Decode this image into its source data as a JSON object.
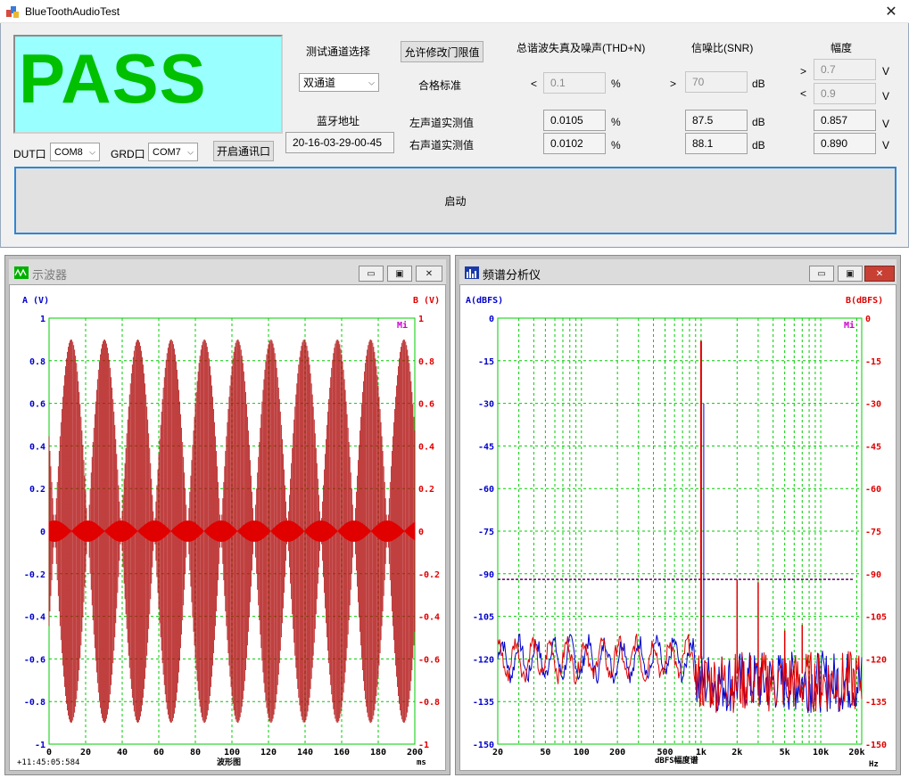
{
  "window": {
    "title": "BlueToothAudioTest",
    "close_glyph": "✕"
  },
  "status": {
    "result": "PASS"
  },
  "ports": {
    "dut_label": "DUT口",
    "dut_value": "COM8",
    "grd_label": "GRD口",
    "grd_value": "COM7",
    "open_button": "开启通讯口"
  },
  "channel": {
    "label": "测试通道选择",
    "value": "双通道"
  },
  "bluetooth": {
    "label": "蓝牙地址",
    "value": "20-16-03-29-00-45"
  },
  "limits": {
    "edit_button": "允许修改门限值",
    "standard_label": "合格标准"
  },
  "rows": {
    "left_label": "左声道实测值",
    "right_label": "右声道实测值"
  },
  "thd": {
    "header": "总谐波失真及噪声(THD+N)",
    "op": "<",
    "limit": "0.1",
    "unit": "%",
    "left": "0.0105",
    "right": "0.0102"
  },
  "snr": {
    "header": "信噪比(SNR)",
    "op": ">",
    "limit": "70",
    "unit": "dB",
    "left": "87.5",
    "right": "88.1"
  },
  "amplitude": {
    "header": "幅度",
    "op_min": ">",
    "min": "0.7",
    "op_max": "<",
    "max": "0.9",
    "unit": "V",
    "left": "0.857",
    "right": "0.890"
  },
  "start_button": "启动",
  "icons": {
    "app": "bluetooth-app-icon",
    "oscilloscope": "oscilloscope-icon",
    "spectrum": "spectrum-icon"
  },
  "oscilloscope": {
    "title": "示波器",
    "left_axis_title": "A (V)",
    "right_axis_title": "B (V)",
    "corner_marker": "Mi",
    "timestamp": "+11:45:05:584",
    "x_title": "波形图",
    "x_unit": "ms",
    "minimize_glyph": "▭",
    "maximize_glyph": "▣",
    "close_glyph": "✕"
  },
  "spectrum": {
    "title": "频谱分析仪",
    "left_axis_title": "A(dBFS)",
    "right_axis_title": "B(dBFS)",
    "corner_marker": "Mi",
    "x_title": "dBFS幅度谱",
    "x_unit": "Hz",
    "minimize_glyph": "▭",
    "maximize_glyph": "▣",
    "close_glyph": "✕"
  },
  "colors": {
    "pass_bg": "#99ffff",
    "pass_text": "#00c000",
    "channel_a": "#0000cc",
    "channel_b": "#e00000",
    "grid": "#00cc00",
    "start_border": "#2e86d4",
    "threshold": "#660066"
  },
  "chart_data": [
    {
      "type": "line",
      "x": [
        0,
        200
      ],
      "x_ticks": [
        0,
        20,
        40,
        60,
        80,
        100,
        120,
        140,
        160,
        180,
        200
      ],
      "xlim": [
        0,
        200
      ],
      "ylim": [
        -1,
        1
      ],
      "y_ticks_left": [
        "1",
        "0.8",
        "0.6",
        "0.4",
        "0.2",
        "0",
        "-0.2",
        "-0.4",
        "-0.6",
        "-0.8",
        "-1"
      ],
      "y_ticks_right": [
        "1",
        "0.8",
        "0.6",
        "0.4",
        "0.2",
        "0",
        "-0.2",
        "-0.4",
        "-0.6",
        "-0.8",
        "-1"
      ],
      "y_tick_values": [
        1,
        0.8,
        0.6,
        0.4,
        0.2,
        0,
        -0.2,
        -0.4,
        -0.6,
        -0.8,
        -1
      ],
      "carrier_khz": 1,
      "envelope_period_ms": 18.2,
      "envelope_peaks": 11,
      "series": [
        {
          "peak": 0.9
        },
        {
          "peak": 0.05
        }
      ],
      "grid": true
    },
    {
      "type": "line",
      "x_scale": "log",
      "xlim": [
        20,
        22000
      ],
      "ylim": [
        -150,
        0
      ],
      "x_ticks": [
        "20",
        "50",
        "100",
        "200",
        "500",
        "1k",
        "2k",
        "5k",
        "10k",
        "20k"
      ],
      "x_tick_values": [
        20,
        50,
        100,
        200,
        500,
        1000,
        2000,
        5000,
        10000,
        20000
      ],
      "y_ticks_left": [
        "0",
        "-15",
        "-30",
        "-45",
        "-60",
        "-75",
        "-90",
        "-105",
        "-120",
        "-135",
        "-150"
      ],
      "y_ticks_right": [
        "0",
        "-15",
        "-30",
        "-45",
        "-60",
        "-75",
        "-90",
        "-105",
        "-120",
        "-135",
        "-150"
      ],
      "y_tick_values": [
        0,
        -15,
        -30,
        -45,
        -60,
        -75,
        -90,
        -105,
        -120,
        -135,
        -150
      ],
      "threshold_dbfs": -92,
      "fundamental_hz": 1000,
      "fundamental_dbfs": -8,
      "harmonics": [
        {
          "hz": 2000,
          "dbfs": -92
        },
        {
          "hz": 3000,
          "dbfs": -93
        },
        {
          "hz": 5000,
          "dbfs": -110
        },
        {
          "hz": 7000,
          "dbfs": -108
        }
      ],
      "noise_floor_low_dbfs": -120,
      "noise_floor_high_dbfs": -128,
      "grid": true
    }
  ]
}
